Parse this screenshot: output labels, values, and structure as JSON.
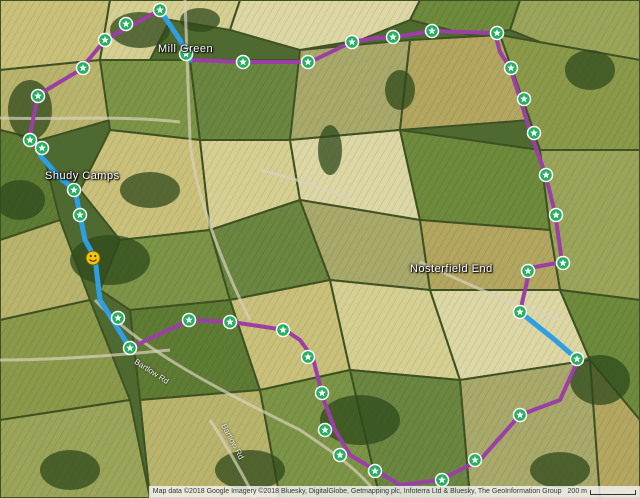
{
  "map": {
    "place_labels": [
      {
        "id": "millgreen",
        "text": "Mill Green"
      },
      {
        "id": "shudy-camps",
        "text": "Shudy Camps"
      },
      {
        "id": "nosterfield-end",
        "text": "Nosterfield End"
      }
    ],
    "road_labels": [
      {
        "id": "bartlow-rd-1",
        "text": "Bartlow Rd"
      },
      {
        "id": "bartlow-rd-2",
        "text": "Bartlow Rd"
      }
    ],
    "attribution": "Map data ©2018 Google Imagery ©2018 Bluesky, DigitalGlobe, Getmapping plc, Infoterra Ltd & Bluesky, The GeoInformation Group",
    "scale_label": "200 m",
    "colors": {
      "route_main": "#9b3fa6",
      "route_highlight": "#2f9fe3",
      "waypoint": "#27ae60",
      "current_location": "#f2c40f"
    },
    "icons": {
      "waypoint": "star-marker-icon",
      "current_location": "smiley-face-icon"
    }
  }
}
